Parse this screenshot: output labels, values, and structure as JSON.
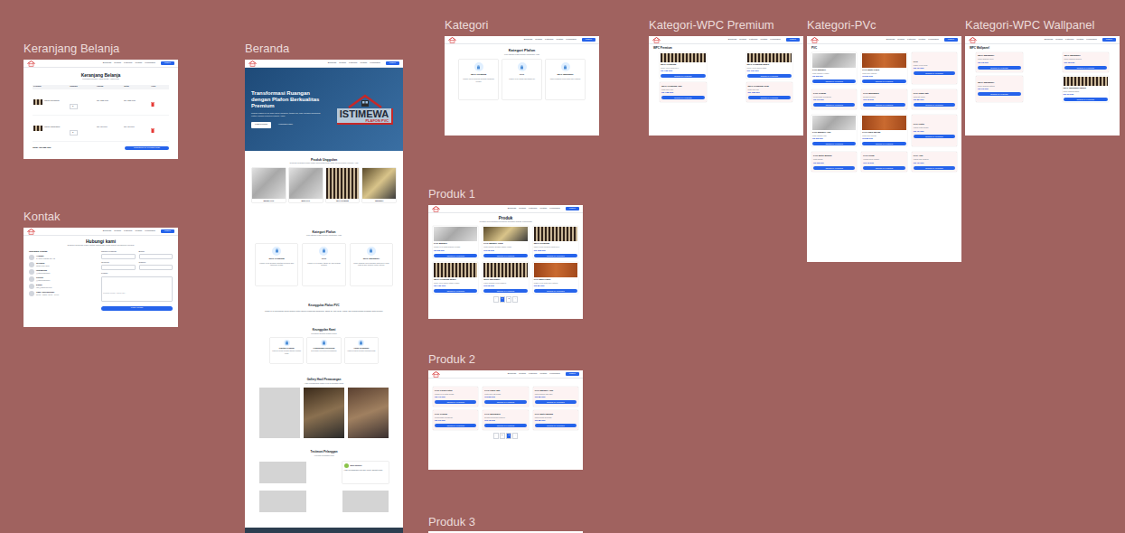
{
  "nav": {
    "links": [
      "Beranda",
      "Produk",
      "Kategori",
      "Kontak",
      "Keranjang"
    ],
    "button": "Masuk"
  },
  "frames": [
    {
      "kind": "cart",
      "title": "Keranjang Belanja",
      "heading": "Keranjang Belanja",
      "subtitle": "Periksa produk yang telah Anda pilih",
      "columns": [
        "Produk",
        "Jumlah",
        "Harga",
        "Total",
        "Aksi"
      ],
      "rows": [
        {
          "name": "WPC Premium",
          "qty": "1",
          "price": "Rp 125.000",
          "total": "Rp 125.000"
        },
        {
          "name": "WPC Wallpanel",
          "qty": "1",
          "price": "Rp 95.000",
          "total": "Rp 95.000"
        }
      ],
      "total": "Total: Rp 220.000",
      "checkout": "Lanjutkan ke Pembayaran"
    },
    {
      "kind": "contact",
      "title": "Kontak",
      "heading": "Hubungi kami",
      "subtitle": "Silakan hubungi kami untuk informasi lebih lanjut mengenai produk",
      "info_title": "Informasi Kontak",
      "info": [
        {
          "label": "Alamat",
          "value": "Jl. Raya Industri No. 12"
        },
        {
          "label": "Telepon",
          "value": "0812-3456-7890"
        },
        {
          "label": "Instagram",
          "value": "@istimewaplafon"
        },
        {
          "label": "TikTok",
          "value": "@istimewaplafon"
        },
        {
          "label": "Email",
          "value": "info@istimewa.com"
        },
        {
          "label": "Jam Operasional",
          "value": "Senin - Sabtu, 08.00 - 17.00"
        }
      ],
      "fields": [
        "Nama Lengkap",
        "Email",
        "Telepon",
        "Subjek"
      ],
      "message_label": "Pesan",
      "message_placeholder": "Tuliskan pesan Anda di sini...",
      "submit": "Kirim Pesan"
    },
    {
      "kind": "home",
      "title": "Beranda",
      "hero": {
        "title": "Transformasi Ruangan dengan Plafon Berkualitas Premium",
        "text": "Solusi plafon PVC dan WPC modern, tahan air, dan mudah dipasang untuk rumah maupun bisnis Anda.",
        "buttons": [
          "Lihat Produk",
          "Hubungi Kami"
        ],
        "logo": "ISTIMEWA",
        "logo_sub": "PLAFON PVC"
      },
      "featured": {
        "title": "Produk Unggulan",
        "subtitle": "Temukan berbagai pilihan plafon berkualitas tinggi untuk mempercantik ruangan Anda",
        "items": [
          {
            "name": "Marmer PVC",
            "kind": "marble"
          },
          {
            "name": "Motif PVC",
            "kind": "marble"
          },
          {
            "name": "WPC Premium",
            "kind": "stripe"
          },
          {
            "name": "Wallpanel",
            "kind": "gold"
          }
        ]
      },
      "categories": {
        "title": "Kategori Plafon",
        "subtitle": "Pilih kategori plafon sesuai kebutuhan Anda",
        "items": [
          {
            "name": "WPC Premium",
            "text": "Plafon WPC dengan kualitas premium dan tampilan elegan"
          },
          {
            "name": "PVC",
            "text": "Plafon PVC ringan, tahan air, dan mudah dirawat"
          },
          {
            "name": "WPC Wallpanel",
            "text": "Panel dinding WPC dengan motif kayu yang natural dan modern untuk interior"
          }
        ]
      },
      "about": {
        "title": "Keunggulan Plafon PVC",
        "text": "Plafon PVC merupakan solusi modern untuk interior rumah dan bangunan. Tahan air, anti rayap, ringan, dan tersedia dalam berbagai motif menarik."
      },
      "features": {
        "title": "Keunggulan Kami",
        "subtitle": "Mengapa memilih produk kami?",
        "items": [
          {
            "name": "Kualitas Premium",
            "text": "Material pilihan dengan standar kualitas tinggi"
          },
          {
            "name": "Pemasangan Profesional",
            "text": "Dikerjakan oleh tim berpengalaman"
          },
          {
            "name": "Harga Terjangkau",
            "text": "Harga bersaing dengan kualitas terbaik"
          }
        ]
      },
      "gallery": {
        "title": "Gallery Hasil Pemasangan",
        "subtitle": "Hasil pemasangan plafon PVC di berbagai lokasi"
      },
      "testimonials": {
        "title": "Testimoni Pelanggan",
        "subtitle": "Apa kata pelanggan kami",
        "items": [
          {
            "name": "Budi Santoso",
            "text": "Hasil pemasangan rapi dan cepat. Sangat puas!"
          }
        ]
      }
    },
    {
      "kind": "category",
      "title": "Kategori",
      "heading": "Kategori Plafon",
      "subtitle": "Pilih kategori plafon sesuai kebutuhan Anda",
      "items": [
        {
          "name": "WPC Premium",
          "text": "Plafon WPC premium dengan tampilan elegan"
        },
        {
          "name": "PVC",
          "text": "Plafon PVC ringan dan tahan air"
        },
        {
          "name": "WPC Wallpanel",
          "text": "Panel dinding WPC motif kayu natural"
        }
      ]
    },
    {
      "kind": "products",
      "title": "Produk 1",
      "heading": "Produk",
      "subtitle": "Pilihan berkualitas premium dengan harga kompetitif",
      "card_button": "Tambah ke Keranjang",
      "cards": [
        {
          "name": "PVC Marmer",
          "desc": "Plafon PVC motif marmer elegan",
          "price": "Rp 85.000",
          "kind": "marble"
        },
        {
          "name": "PVC Marmer Gold",
          "desc": "Motif marmer dengan aksen emas",
          "price": "Rp 95.000",
          "kind": "gold"
        },
        {
          "name": "WPC Premium",
          "desc": "Panel WPC premium motif kayu",
          "price": "Rp 125.000",
          "kind": "stripe"
        },
        {
          "name": "WPC Premium Black",
          "desc": "Panel WPC warna hitam elegan",
          "price": "Rp 130.000",
          "kind": "stripe"
        },
        {
          "name": "WPC Wallpanel",
          "desc": "Panel dinding WPC modern",
          "price": "Rp 95.000",
          "kind": "stripe"
        },
        {
          "name": "PVC Motif Kayu",
          "desc": "Plafon PVC motif kayu natural",
          "price": "Rp 80.000",
          "kind": "wood"
        }
      ],
      "pages": [
        {
          "label": "‹",
          "selected": false
        },
        {
          "label": "1",
          "selected": true
        },
        {
          "label": "2",
          "selected": false
        },
        {
          "label": "›",
          "selected": false
        }
      ]
    },
    {
      "kind": "products",
      "title": "Produk 2",
      "heading": "",
      "subtitle": "",
      "card_button": "Tambah ke Keranjang",
      "cards": [
        {
          "name": "PVC Polos Putih",
          "desc": "Plafon PVC putih bersih",
          "price": "Rp 70.000",
          "kind": "none"
        },
        {
          "name": "PVC Kayu Jati",
          "desc": "Motif kayu jati klasik",
          "price": "Rp 85.000",
          "kind": "none"
        },
        {
          "name": "PVC Marmer Abu",
          "desc": "Motif marmer abu-abu",
          "price": "Rp 85.000",
          "kind": "none"
        },
        {
          "name": "PVC Glossy",
          "desc": "Permukaan mengkilap",
          "price": "Rp 90.000",
          "kind": "none"
        },
        {
          "name": "PVC Minimalis",
          "desc": "Desain minimalis modern",
          "price": "Rp 75.000",
          "kind": "none"
        },
        {
          "name": "PVC Motif Bunga",
          "desc": "Motif bunga dekoratif",
          "price": "Rp 88.000",
          "kind": "none"
        }
      ],
      "pages": [
        {
          "label": "‹",
          "selected": false
        },
        {
          "label": "1",
          "selected": false
        },
        {
          "label": "2",
          "selected": true
        },
        {
          "label": "›",
          "selected": false
        }
      ]
    },
    {
      "kind": "stub",
      "title": "Produk 3"
    },
    {
      "kind": "catproducts",
      "title": "Kategori-WPC Premium",
      "heading": "WPC Premium",
      "card_button": "Tambah ke Keranjang",
      "cards": [
        {
          "name": "WPC Premium",
          "desc": "Panel WPC motif kayu",
          "price": "Rp 125.000",
          "kind": "stripe"
        },
        {
          "name": "WPC Premium Black",
          "desc": "Panel WPC warna hitam",
          "price": "Rp 130.000",
          "kind": "stripe"
        },
        {
          "name": "WPC Premium Oak",
          "desc": "Motif kayu oak",
          "price": "Rp 128.000",
          "kind": "none"
        },
        {
          "name": "WPC Premium Teak",
          "desc": "Motif kayu jati",
          "price": "Rp 128.000",
          "kind": "none"
        }
      ]
    },
    {
      "kind": "catproducts",
      "title": "Kategori-PVc",
      "heading": "PVC",
      "card_button": "Tambah ke Keranjang",
      "cards": [
        {
          "name": "PVC Marmer",
          "desc": "Motif marmer elegan",
          "price": "Rp 85.000",
          "kind": "marble"
        },
        {
          "name": "PVC Motif Kayu",
          "desc": "Motif kayu natural",
          "price": "Rp 80.000",
          "kind": "wood"
        },
        {
          "name": "PVC",
          "desc": "Plafon PVC polos",
          "price": "Rp 70.000",
          "kind": "none"
        },
        {
          "name": "PVC Glossy",
          "desc": "Permukaan mengkilap",
          "price": "Rp 90.000",
          "kind": "none"
        },
        {
          "name": "PVC Minimalis",
          "desc": "Desain modern",
          "price": "Rp 75.000",
          "kind": "none"
        },
        {
          "name": "PVC Kayu Jati",
          "desc": "Motif jati klasik",
          "price": "Rp 85.000",
          "kind": "none"
        },
        {
          "name": "PVC Marmer Abu",
          "desc": "Motif marmer abu",
          "price": "Rp 85.000",
          "kind": "marble"
        },
        {
          "name": "PVC Kayu Merah",
          "desc": "Motif kayu merah",
          "price": "Rp 82.000",
          "kind": "wood"
        },
        {
          "name": "PVC Putih",
          "desc": "Warna putih bersih",
          "price": "Rp 70.000",
          "kind": "none"
        },
        {
          "name": "PVC Motif Bunga",
          "desc": "Motif bunga",
          "price": "Rp 88.000",
          "kind": "none"
        },
        {
          "name": "PVC Krem",
          "desc": "Warna krem lembut",
          "price": "Rp 72.000",
          "kind": "none"
        },
        {
          "name": "PVC Abu",
          "desc": "Warna abu modern",
          "price": "Rp 72.000",
          "kind": "none"
        }
      ]
    },
    {
      "kind": "catproducts",
      "title": "Kategori-WPC Wallpanel",
      "heading": "WPC Wallpanel",
      "card_button": "Tambah ke Keranjang",
      "cards": [
        {
          "name": "WPC Wallpanel",
          "desc": "Panel dinding WPC",
          "price": "Rp 95.000",
          "kind": "none"
        },
        {
          "name": "WPC Wallpanel",
          "desc": "Panel dinding modern",
          "price": "Rp 98.000",
          "kind": "none"
        },
        {
          "name": "WPC Wallpanel",
          "desc": "Panel dinding natural",
          "price": "Rp 96.000",
          "kind": "none"
        },
        {
          "name": "WPC Wallpanel Black",
          "desc": "Panel dinding hitam",
          "price": "Rp 99.000",
          "kind": "stripe"
        }
      ]
    }
  ]
}
